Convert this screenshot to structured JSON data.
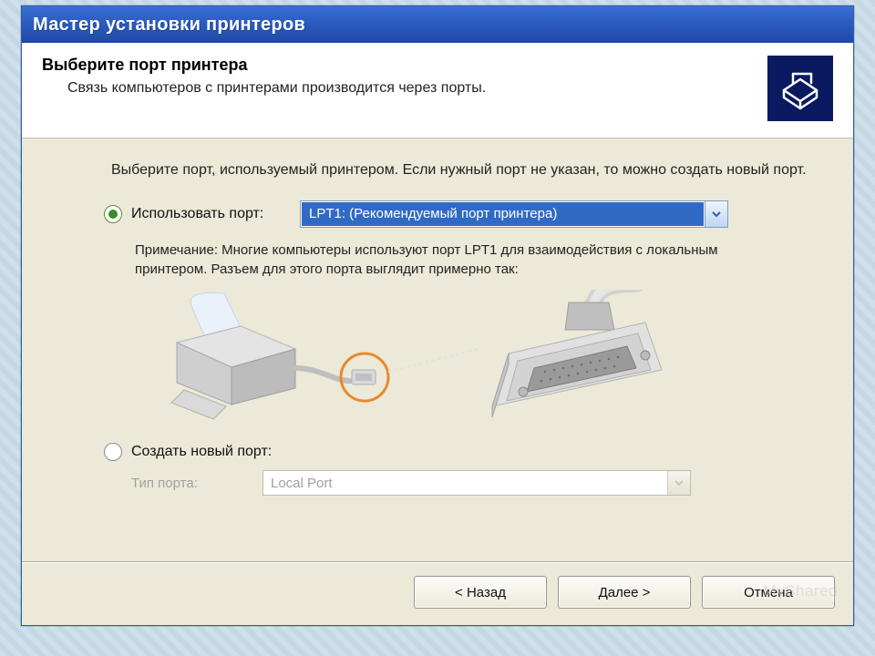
{
  "window": {
    "title": "Мастер установки принтеров"
  },
  "header": {
    "title": "Выберите порт принтера",
    "subtitle": "Связь компьютеров с принтерами производится через порты."
  },
  "body": {
    "instruction": "Выберите порт, используемый принтером. Если нужный порт не указан, то можно создать новый порт.",
    "use_port": {
      "label": "Использовать порт:",
      "selected": "LPT1: (Рекомендуемый порт принтера)"
    },
    "note": "Примечание: Многие компьютеры используют порт LPT1 для взаимодействия с локальным принтером. Разъем для этого порта выглядит примерно так:",
    "create_port": {
      "label": "Создать новый порт:",
      "type_label": "Тип порта:",
      "type_value": "Local Port"
    }
  },
  "footer": {
    "back": "< Назад",
    "next": "Далее >",
    "cancel": "Отмена"
  },
  "watermark": "MyShared"
}
